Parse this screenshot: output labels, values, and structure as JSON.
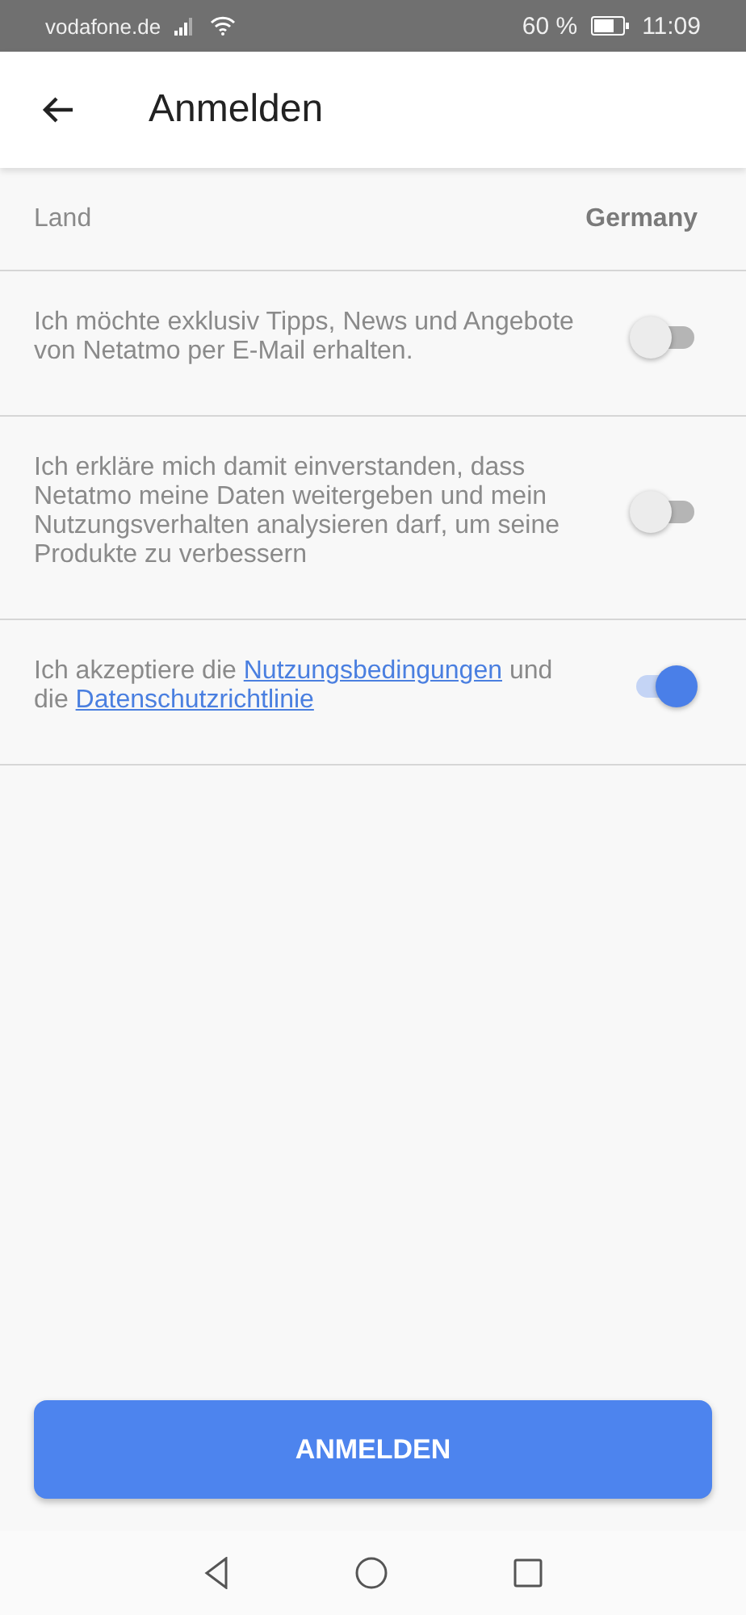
{
  "status_bar": {
    "carrier": "vodafone.de",
    "battery": "60 %",
    "time": "11:09"
  },
  "app_bar": {
    "title": "Anmelden"
  },
  "rows": [
    {
      "kind": "value",
      "label": "Land",
      "value": "Germany"
    },
    {
      "kind": "toggle",
      "on": false,
      "parts": [
        {
          "text": "Ich möchte exklusiv Tipps, News und Angebote von Netatmo per E-Mail erhalten.",
          "link": false
        }
      ]
    },
    {
      "kind": "toggle",
      "on": false,
      "parts": [
        {
          "text": "Ich erkläre mich damit einverstanden, dass Netatmo meine Daten weitergeben und mein Nutzungsverhalten analysieren darf, um seine Produkte zu verbessern",
          "link": false
        }
      ]
    },
    {
      "kind": "toggle",
      "on": true,
      "parts": [
        {
          "text": "Ich akzeptiere die ",
          "link": false
        },
        {
          "text": "Nutzungsbedingungen",
          "link": true
        },
        {
          "text": " und die ",
          "link": false
        },
        {
          "text": "Datenschutzrichtlinie",
          "link": true
        }
      ]
    }
  ],
  "button": {
    "label": "ANMELDEN"
  }
}
